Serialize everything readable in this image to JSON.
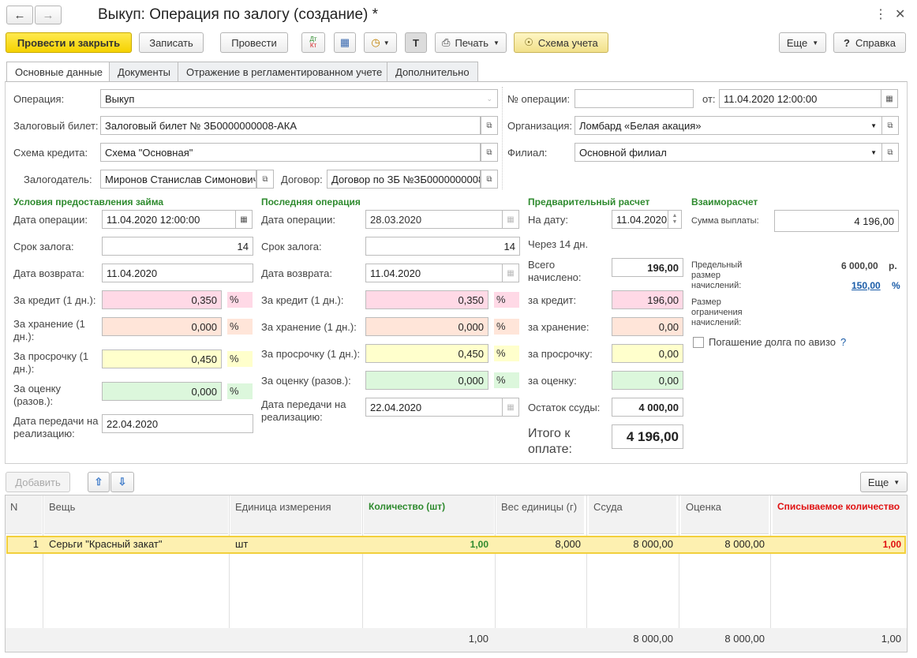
{
  "window": {
    "title": "Выкуп: Операция по залогу (создание) *"
  },
  "toolbar": {
    "post_close": "Провести и закрыть",
    "save": "Записать",
    "post": "Провести",
    "dtkt_top": "Дт",
    "dtkt_bot": "Кт",
    "print": "Печать",
    "schema": "Схема учета",
    "more": "Еще",
    "help": "Справка"
  },
  "tabs": [
    "Основные данные",
    "Документы",
    "Отражение в регламентированном учете",
    "Дополнительно"
  ],
  "header": {
    "operation_label": "Операция:",
    "operation_value": "Выкуп",
    "ticket_label": "Залоговый билет:",
    "ticket_value": "Залоговый билет № ЗБ0000000008-АКА",
    "scheme_label": "Схема кредита:",
    "scheme_value": "Схема \"Основная\"",
    "pledger_label": "Залогодатель:",
    "pledger_value": "Миронов Станислав Симонович",
    "contract_label": "Договор:",
    "contract_value": "Договор по ЗБ №ЗБ0000000008",
    "opnum_label": "№ операции:",
    "opnum_value": "",
    "from_label": "от:",
    "from_value": "11.04.2020 12:00:00",
    "org_label": "Организация:",
    "org_value": "Ломбард «Белая акация»",
    "branch_label": "Филиал:",
    "branch_value": "Основной филиал"
  },
  "loan_terms": {
    "title": "Условия предоставления займа",
    "op_date_label": "Дата операции:",
    "op_date": "11.04.2020 12:00:00",
    "term_label": "Срок залога:",
    "term": "14",
    "return_label": "Дата возврата:",
    "return_date": "11.04.2020",
    "credit_label": "За кредит (1 дн.):",
    "credit": "0,350",
    "storage_label1": "За хранение (1",
    "storage_label2": "дн.):",
    "storage": "0,000",
    "overdue_label1": "За просрочку (1",
    "overdue_label2": "дн.):",
    "overdue": "0,450",
    "eval_label1": "За оценку",
    "eval_label2": "(разов.):",
    "eval": "0,000",
    "transfer_label1": "Дата передачи на",
    "transfer_label2": "реализацию:",
    "transfer": "22.04.2020",
    "pct": "%"
  },
  "last_op": {
    "title": "Последняя операция",
    "op_date_label": "Дата операции:",
    "op_date": "28.03.2020",
    "term_label": "Срок залога:",
    "term": "14",
    "return_label": "Дата возврата:",
    "return_date": "11.04.2020",
    "credit_label": "За кредит (1 дн.):",
    "credit": "0,350",
    "storage_label": "За хранение (1 дн.):",
    "storage": "0,000",
    "overdue_label": "За просрочку (1 дн.):",
    "overdue": "0,450",
    "eval_label": "За оценку (разов.):",
    "eval": "0,000",
    "transfer_label1": "Дата передачи на",
    "transfer_label2": "реализацию:",
    "transfer": "22.04.2020"
  },
  "prelim": {
    "title": "Предварительный расчет",
    "date_label": "На дату:",
    "date": "11.04.2020",
    "through": "Через 14 дн.",
    "total_label1": "Всего",
    "total_label2": "начислено:",
    "total": "196,00",
    "credit_label": "за кредит:",
    "credit": "196,00",
    "storage_label": "за хранение:",
    "storage": "0,00",
    "overdue_label": "за просрочку:",
    "overdue": "0,00",
    "eval_label": "за оценку:",
    "eval": "0,00",
    "rest_label": "Остаток ссуды:",
    "rest": "4 000,00",
    "pay_label1": "Итого к",
    "pay_label2": "оплате:",
    "pay": "4 196,00"
  },
  "settlement": {
    "title": "Взаиморасчет",
    "payout_label": "Сумма выплаты:",
    "payout": "4 196,00",
    "limit_label1": "Предельный",
    "limit_label2": "размер",
    "limit_label3": "начислений:",
    "limit_value": "6 000,00",
    "limit_unit": "р.",
    "limit_pct": "150,00",
    "limit_pct_unit": "%",
    "restr_label1": "Размер",
    "restr_label2": "ограничения",
    "restr_label3": "начислений:",
    "advice_label": "Погашение долга по авизо",
    "help_q": "?"
  },
  "table_toolbar": {
    "add": "Добавить",
    "more": "Еще"
  },
  "table": {
    "headers": [
      "N",
      "Вещь",
      "Единица измерения",
      "Количество (шт)",
      "Вес единицы (г)",
      "Ссуда",
      "Оценка",
      "Списываемое количество"
    ],
    "rows": [
      {
        "n": "1",
        "item": "Серьги \"Красный закат\"",
        "unit": "шт",
        "qty": "1,00",
        "weight": "8,000",
        "loan": "8 000,00",
        "eval": "8 000,00",
        "write_off": "1,00"
      }
    ],
    "totals": {
      "qty": "1,00",
      "loan": "8 000,00",
      "eval": "8 000,00",
      "write_off": "1,00"
    }
  },
  "colors": {
    "accent_yellow": "#f5d200",
    "green_title": "#2e8a2e",
    "red_header": "#e01010",
    "row_selected": "#fdf0b0"
  }
}
